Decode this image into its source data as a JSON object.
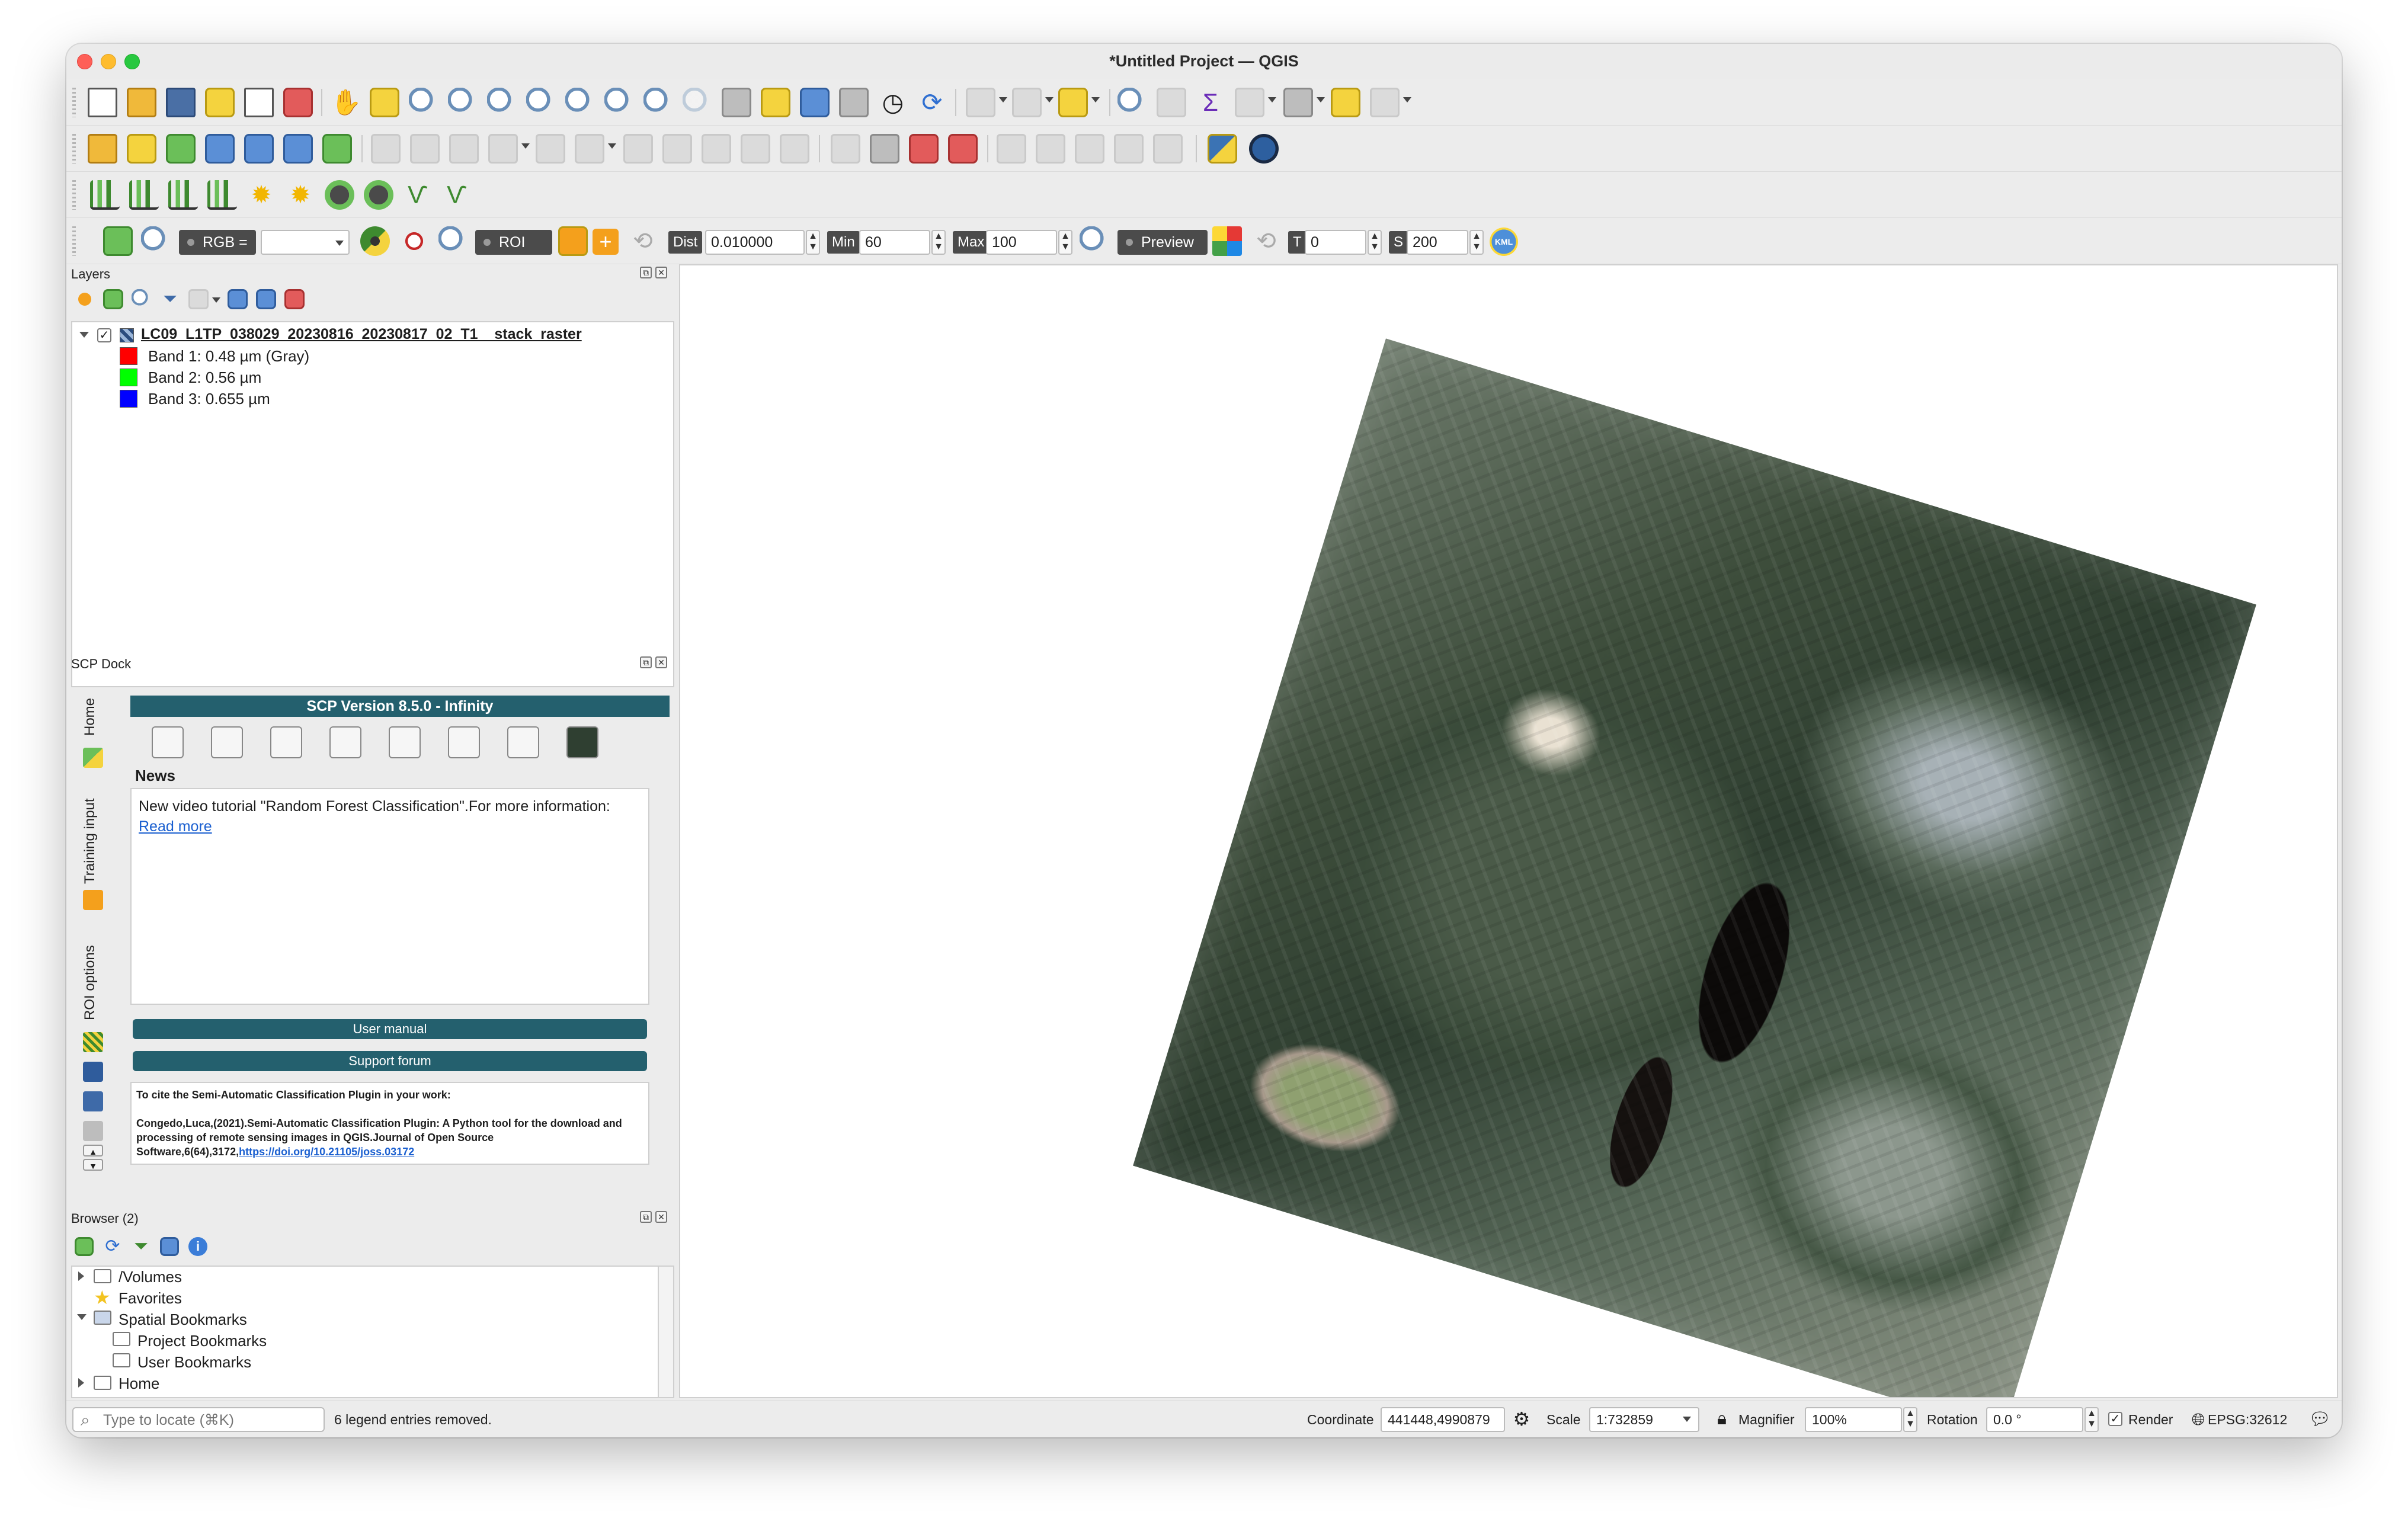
{
  "window": {
    "title": "*Untitled Project — QGIS"
  },
  "toolbar_icons": {
    "row1": [
      "new-project-icon",
      "open-project-icon",
      "save-project-icon",
      "save-as-icon",
      "print-layout-icon",
      "style-manager-icon",
      "pan-icon",
      "pan-to-selection-icon",
      "zoom-in-icon",
      "zoom-out-icon",
      "zoom-full-icon",
      "zoom-selection-icon",
      "zoom-layer-icon",
      "zoom-native-icon",
      "zoom-last-icon",
      "zoom-next-icon",
      "new-map-view-icon",
      "new-3d-view-icon",
      "new-bookmark-icon",
      "show-bookmarks-icon",
      "temporal-controller-icon",
      "refresh-icon",
      "select-features-icon",
      "deselect-icon",
      "select-by-value-icon",
      "identify-icon",
      "attribute-table-icon",
      "statistics-icon",
      "field-calculator-icon",
      "measure-icon",
      "annotation-icon",
      "locator-settings-icon"
    ],
    "row2": [
      "open-datasource-icon",
      "new-geopackage-icon",
      "new-shapefile-icon",
      "new-spatialite-icon",
      "new-virtual-layer-icon",
      "add-raster-icon",
      "add-vector-icon",
      "current-edits-icon",
      "toggle-editing-icon",
      "save-edits-icon",
      "digitize-icon",
      "vertex-tool-icon",
      "delete-selected-icon",
      "cut-icon",
      "copy-icon",
      "paste-icon",
      "undo-icon",
      "redo-icon",
      "label-icon",
      "pin-labels-icon",
      "label-red-icon",
      "python-console-icon",
      "globe-icon"
    ],
    "row3": [
      "scp-band-calc-icon",
      "scp-classification-icon",
      "scp-signature-icon",
      "scp-scatter-icon",
      "scp-sun-icon",
      "scp-sun-add-icon",
      "scp-mask-icon",
      "scp-vector-icon",
      "scp-raster-icon",
      "scp-raster-add-icon"
    ]
  },
  "scp_toolbar": {
    "rgb_label": "RGB =",
    "rgb_value": "",
    "roi_label": "ROI",
    "dist_label": "Dist",
    "dist_value": "0.010000",
    "min_label": "Min",
    "min_value": "60",
    "max_label": "Max",
    "max_value": "100",
    "preview_label": "Preview",
    "t_label": "T",
    "t_value": "0",
    "s_label": "S",
    "s_value": "200",
    "kml_label": "KML"
  },
  "layers_panel": {
    "title": "Layers",
    "layer_name": "LC09_L1TP_038029_20230816_20230817_02_T1__stack_raster",
    "bands": [
      {
        "label": "Band 1: 0.48  µm (Gray)",
        "color": "#ff0000"
      },
      {
        "label": "Band 2: 0.56  µm",
        "color": "#00ff00"
      },
      {
        "label": "Band 3: 0.655 µm",
        "color": "#0000ff"
      }
    ]
  },
  "scp_dock": {
    "title": "SCP Dock",
    "tabs": [
      "Home",
      "Training input",
      "ROI options"
    ],
    "version": "SCP Version 8.5.0 - Infinity",
    "news_label": "News",
    "news_text": "New video tutorial \"Random Forest Classification\".For more information: ",
    "news_link": "Read more",
    "user_manual": "User manual",
    "support_forum": "Support forum",
    "cite_intro": "To cite the Semi-Automatic Classification Plugin in your work:",
    "cite_text": "Congedo,Luca,(2021).Semi-Automatic Classification Plugin: A Python tool for the download and processing of remote sensing images in QGIS.Journal of Open Source Software,6(64),3172,",
    "cite_link": "https://doi.org/10.21105/joss.03172"
  },
  "browser_panel": {
    "title": "Browser (2)",
    "items": [
      "/Volumes",
      "Favorites",
      "Spatial Bookmarks",
      "Project Bookmarks",
      "User Bookmarks",
      "Home"
    ]
  },
  "statusbar": {
    "locator_placeholder": "Type to locate (⌘K)",
    "message": "6 legend entries removed.",
    "coordinate_label": "Coordinate",
    "coordinate_value": "441448,4990879",
    "scale_label": "Scale",
    "scale_value": "1:732859",
    "magnifier_label": "Magnifier",
    "magnifier_value": "100%",
    "rotation_label": "Rotation",
    "rotation_value": "0.0 °",
    "render_label": "Render",
    "crs": "EPSG:32612"
  }
}
